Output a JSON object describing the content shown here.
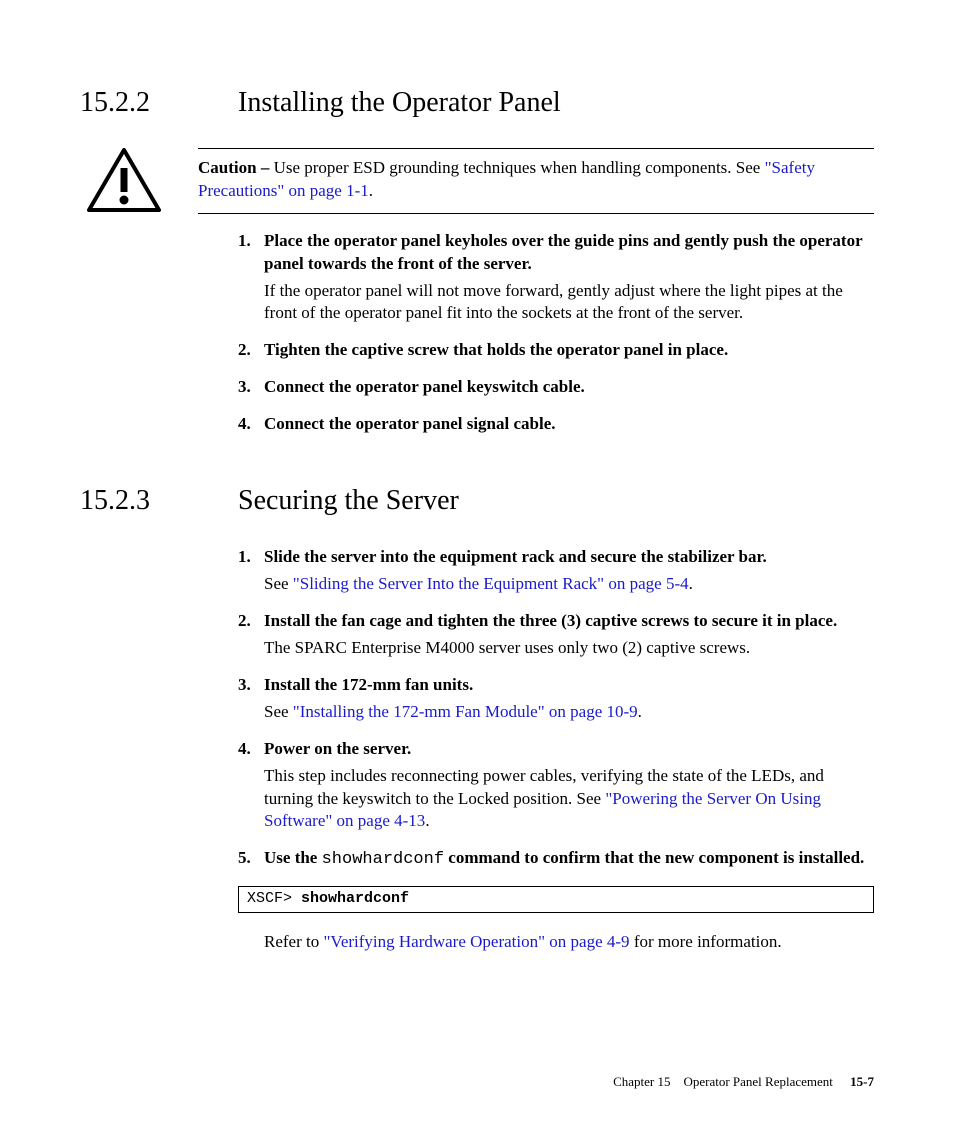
{
  "sections": [
    {
      "number": "15.2.2",
      "title": "Installing the Operator Panel",
      "caution": {
        "label": "Caution –",
        "text_before_link": " Use proper ESD grounding techniques when handling components. See ",
        "link": "\"Safety Precautions\" on page 1-1",
        "text_after_link": "."
      },
      "steps": [
        {
          "n": "1.",
          "head": "Place the operator panel keyholes over the guide pins and gently push the operator panel towards the front of the server.",
          "sub": "If the operator panel will not move forward, gently adjust where the light pipes at the front of the operator panel fit into the sockets at the front of the server."
        },
        {
          "n": "2.",
          "head": "Tighten the captive screw that holds the operator panel in place."
        },
        {
          "n": "3.",
          "head": "Connect the operator panel keyswitch cable."
        },
        {
          "n": "4.",
          "head": "Connect the operator panel signal cable."
        }
      ]
    },
    {
      "number": "15.2.3",
      "title": "Securing the Server",
      "steps": [
        {
          "n": "1.",
          "head": "Slide the server into the equipment rack and secure the stabilizer bar.",
          "sub_pre": "See ",
          "sub_link": "\"Sliding the Server Into the Equipment Rack\" on page 5-4",
          "sub_post": "."
        },
        {
          "n": "2.",
          "head": "Install the fan cage and tighten the three (3) captive screws to secure it in place.",
          "sub": "The SPARC Enterprise M4000 server uses only two (2) captive screws."
        },
        {
          "n": "3.",
          "head": "Install the 172-mm fan units.",
          "sub_pre": "See ",
          "sub_link": "\"Installing the 172-mm Fan Module\" on page 10-9",
          "sub_post": "."
        },
        {
          "n": "4.",
          "head": "Power on the server.",
          "sub_pre": "This step includes reconnecting power cables, verifying the state of the LEDs, and turning the keyswitch to the Locked position. See ",
          "sub_link": "\"Powering the Server On Using Software\" on page 4-13",
          "sub_post": "."
        },
        {
          "n": "5.",
          "head_pre": "Use the ",
          "head_code": "showhardconf",
          "head_post": " command to confirm that the new component is installed."
        }
      ],
      "codebox": {
        "prompt": "XSCF> ",
        "command": "showhardconf"
      },
      "after_code": {
        "pre": "Refer to ",
        "link": "\"Verifying Hardware Operation\" on page 4-9",
        "post": " for more information."
      }
    }
  ],
  "footer": {
    "chapter_label": "Chapter 15",
    "chapter_title": "Operator Panel Replacement",
    "page_num": "15-7"
  }
}
